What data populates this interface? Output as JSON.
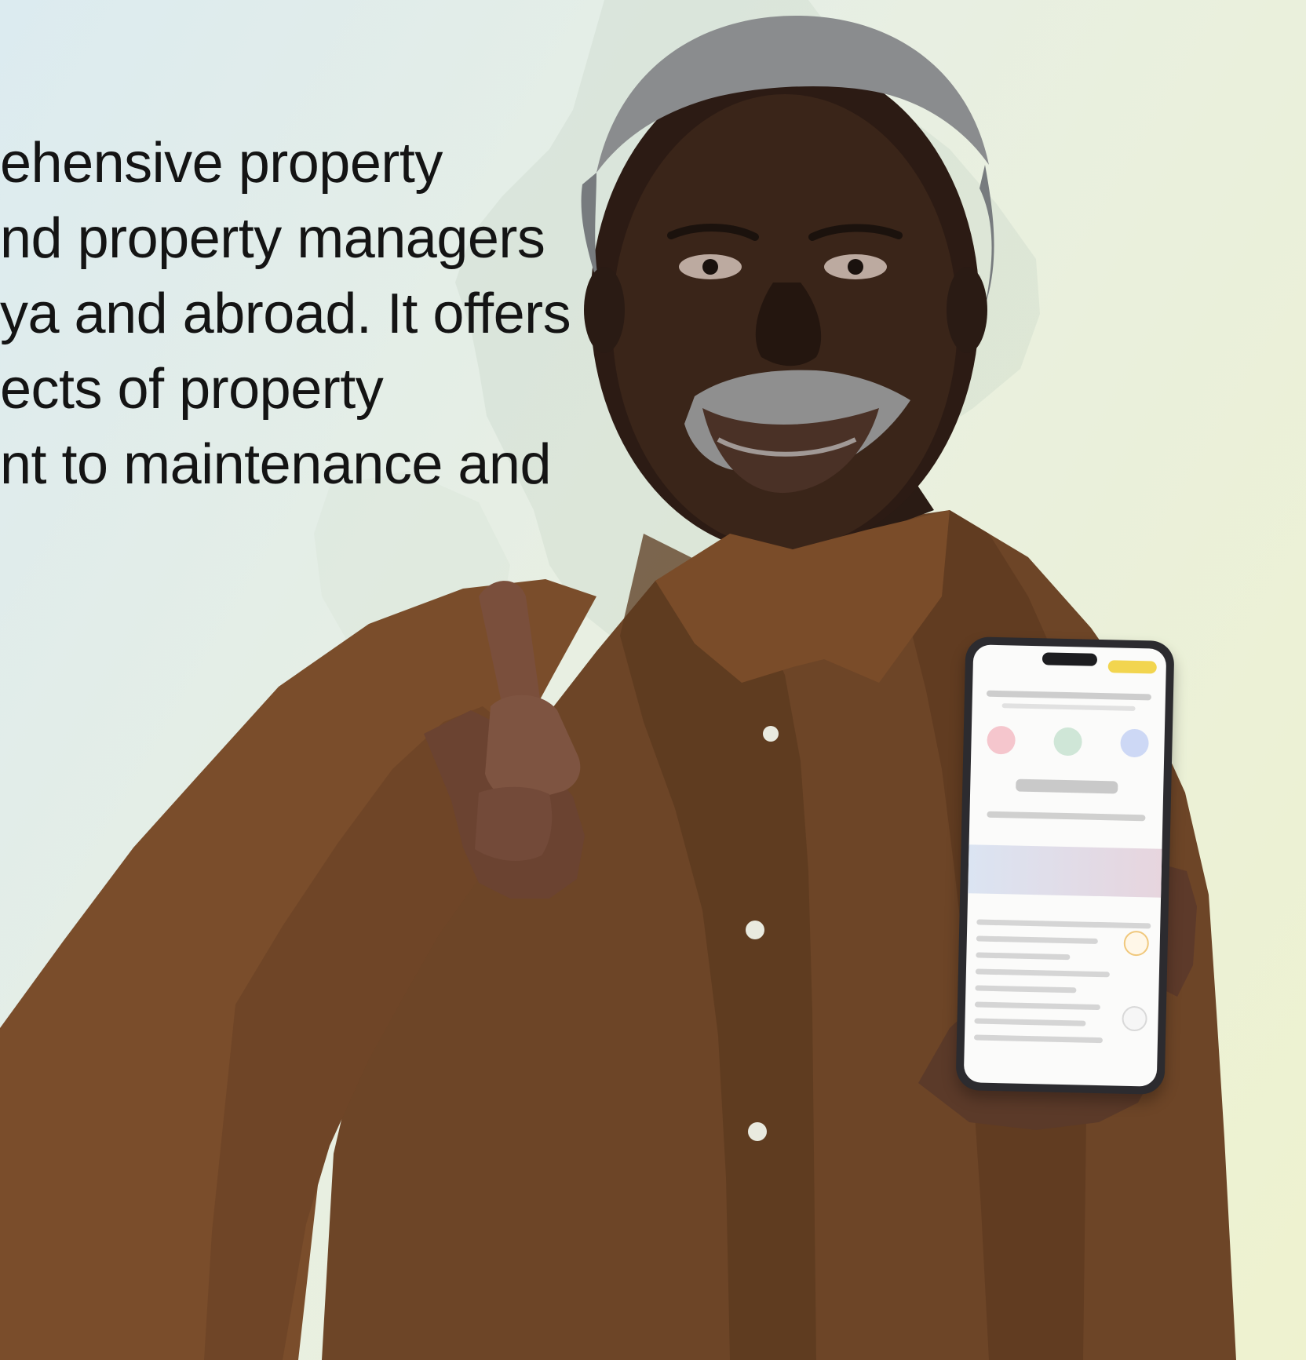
{
  "promo": {
    "lines": [
      "ehensive property",
      "nd property managers",
      "ya and abroad. It offers",
      "ects of property",
      "nt to maintenance and"
    ]
  },
  "icons": {
    "map": "world-map-background",
    "phone": "smartphone-icon"
  },
  "colors": {
    "text": "#141414",
    "phone_accent": "#f2d54f"
  }
}
